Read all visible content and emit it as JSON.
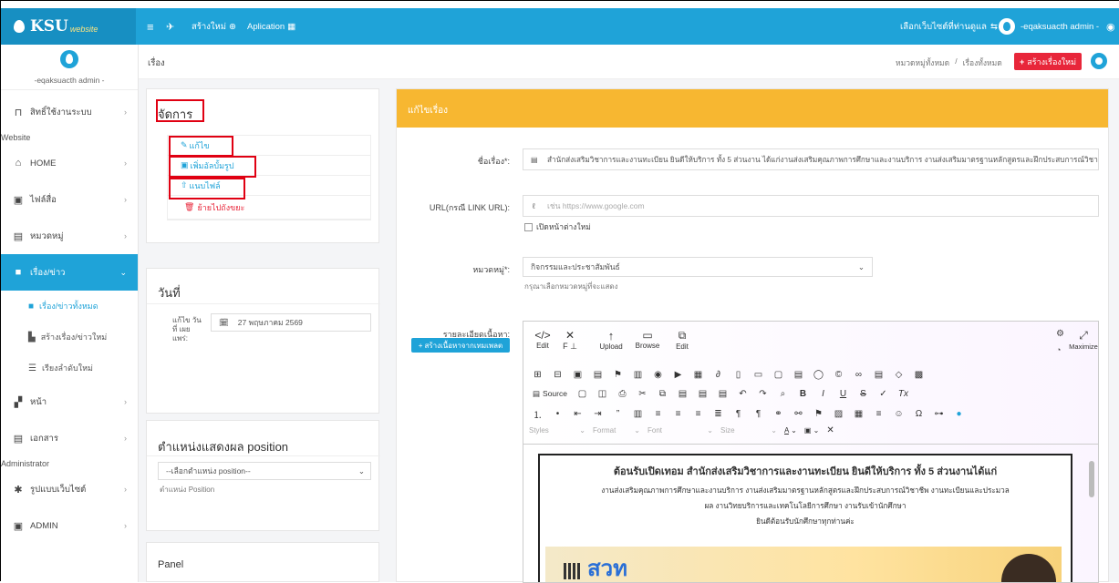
{
  "topbar": {
    "brand": "KSU",
    "brand_sub": "website",
    "menu_icon": "hamburger-icon",
    "create_new": "สร้างใหม่",
    "application": "Aplication",
    "choose_site": "เลือกเว็บไซต์ที่ท่านดูแล",
    "user": "-eqaksuacth admin -"
  },
  "sidebar": {
    "user": "-eqaksuacth admin -",
    "items": [
      {
        "label": "สิทธิ์ใช้งานระบบ",
        "icon": "lock-icon"
      },
      {
        "section": "Website"
      },
      {
        "label": "HOME",
        "icon": "home-icon"
      },
      {
        "label": "ไฟล์สื่อ",
        "icon": "image-icon"
      },
      {
        "label": "หมวดหมู่",
        "icon": "list-icon"
      },
      {
        "label": "เรื่อง/ข่าว",
        "icon": "folder-icon",
        "active": true
      },
      {
        "label": "เรื่อง/ข่าวทั้งหมด",
        "icon": "folder-icon",
        "sub": true,
        "current": true
      },
      {
        "label": "สร้างเรื่อง/ข่าวใหม่",
        "icon": "file-plus-icon",
        "sub": true
      },
      {
        "label": "เรียงลำดับใหม่",
        "icon": "sort-icon",
        "sub": true
      },
      {
        "label": "หน้า",
        "icon": "page-icon"
      },
      {
        "label": "เอกสาร",
        "icon": "document-icon"
      },
      {
        "section": "Administrator"
      },
      {
        "label": "รูปแบบเว็บไซต์",
        "icon": "palette-icon"
      },
      {
        "label": "ADMIN",
        "icon": "admin-icon"
      }
    ]
  },
  "pagebar": {
    "title": "เรื่อง",
    "breadcrumb_1": "หมวดหมู่ทั้งหมด",
    "breadcrumb_sep": "/",
    "breadcrumb_2": "เรื่องทั้งหมด",
    "create_button": "สร้างเรื่องใหม่"
  },
  "manage": {
    "title": "จัดการ",
    "actions": {
      "edit": "แก้ไข",
      "add_album": "เพิ่มอัลบั้มรูป",
      "attach": "แนบไฟล์",
      "trash": "ย้ายไปถังขยะ"
    }
  },
  "date_card": {
    "title": "วันที่",
    "label": "แก้ไข วันที่ เผย แพร่:",
    "value": "27 พฤษภาคม 2569"
  },
  "position_card": {
    "title": "ตำแหน่งแสดงผล position",
    "select": "--เลือกตำแหน่ง position--",
    "hint": "ตำแหน่ง Position"
  },
  "panel_card": {
    "title": "Panel"
  },
  "edit_form": {
    "header": "แก้ไขเรื่อง",
    "title_label": "ชื่อเรื่อง*:",
    "title_value": "สำนักส่งเสริมวิชาการและงานทะเบียน ยินดีให้บริการ ทั้ง 5 ส่วนงาน ได้แก่งานส่งเสริมคุณภาพการศึกษาและงานบริการ งานส่งเสริมมาตรฐานหลักสูตรและฝึกประสบการณ์วิชาชี",
    "url_label": "URL(กรณี LINK URL):",
    "url_placeholder": "เช่น https://www.google.com",
    "new_tab": "เปิดหน้าต่างใหม่",
    "category_label": "หมวดหมู่*:",
    "category_value": "กิจกรรมและประชาสัมพันธ์",
    "category_hint": "กรุณาเลือกหมวดหมู่ที่จะแสดง",
    "content_label": "รายละเอียดเนื้อหา:",
    "template_button": "สร้างเนื้อหาจากเทมเพลต"
  },
  "editor": {
    "row1": [
      {
        "label": "Edit",
        "icon": "code-icon"
      },
      {
        "label": "",
        "icon": "close-format-icon"
      },
      {
        "label": "Upload",
        "icon": "upload-icon"
      },
      {
        "label": "Browse",
        "icon": "folder-icon"
      },
      {
        "label": "Edit",
        "icon": "image-edit-icon"
      }
    ],
    "maximize": "Maximize",
    "source": "Source",
    "styles": "Styles",
    "format": "Format",
    "font": "Font",
    "size": "Size",
    "content_heading": "ต้อนรับเปิดเทอม สำนักส่งเสริมวิชาการและงานทะเบียน ยินดีให้บริการ ทั้ง 5 ส่วนงานได้แก่",
    "content_line1": "งานส่งเสริมคุณภาพการศึกษาและงานบริการ งานส่งเสริมมาตรฐานหลักสูตรและฝึกประสบการณ์วิชาชีพ งานทะเบียนและประมวล",
    "content_line2": "ผล งานวิทยบริการและเทคโนโลยีการศึกษา งานรับเข้านักศึกษา",
    "content_line3": "ยินดีต้อนรับนักศึกษาทุกท่านค่ะ",
    "banner_text": "สวท"
  },
  "colors": {
    "brand": "#1fa3d8",
    "accent": "#f7b731",
    "danger": "#e8263a",
    "highlight": "#e00012"
  }
}
